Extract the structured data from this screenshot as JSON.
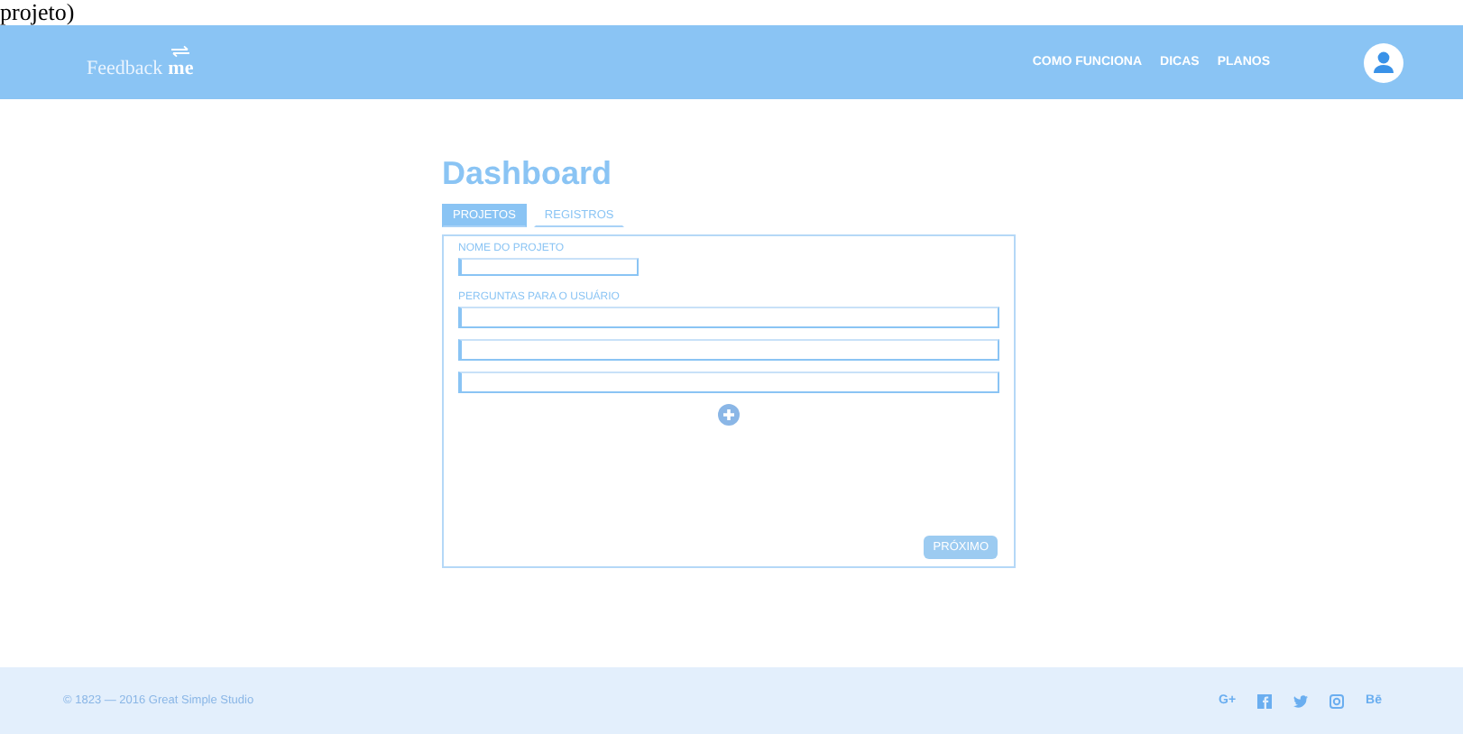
{
  "caption": "projeto)",
  "navbar": {
    "logo": {
      "text": "Feedback",
      "bold": "me"
    },
    "links": [
      "COMO FUNCIONA",
      "DICAS",
      "PLANOS"
    ]
  },
  "title": "Dashboard",
  "tabs": [
    {
      "label": "PROJETOS",
      "selected": true
    },
    {
      "label": "REGISTROS",
      "selected": false
    }
  ],
  "form": {
    "name_label": "NOME DO PROJETO",
    "questions_label": "PERGUNTAS PARA O USUÁRIO",
    "next_button": "PRÓXIMO"
  },
  "footer": {
    "copyright": "© 1823 — 2016 Great Simple Studio",
    "social": [
      {
        "kind": "text",
        "text": "G+"
      },
      {
        "kind": "facebook"
      },
      {
        "kind": "twitter"
      },
      {
        "kind": "instagram"
      },
      {
        "kind": "text",
        "text": "Bē"
      }
    ]
  }
}
